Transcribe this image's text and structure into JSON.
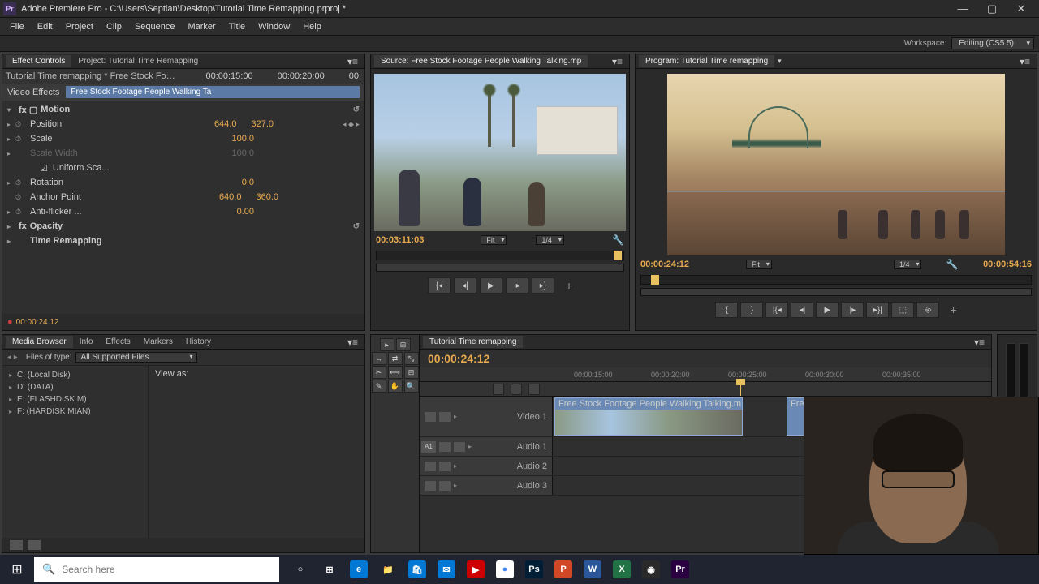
{
  "titlebar": {
    "logo_text": "Pr",
    "title": "Adobe Premiere Pro - C:\\Users\\Septian\\Desktop\\Tutorial Time Remapping.prproj *"
  },
  "menubar": [
    "File",
    "Edit",
    "Project",
    "Clip",
    "Sequence",
    "Marker",
    "Title",
    "Window",
    "Help"
  ],
  "workspace": {
    "label": "Workspace:",
    "value": "Editing (CS5.5)"
  },
  "effect_controls": {
    "tab1": "Effect Controls",
    "tab2": "Project: Tutorial Time Remapping",
    "clip_path": "Tutorial Time remapping * Free Stock Foota...",
    "time1": "00:00:15:00",
    "time2": "00:00:20:00",
    "time3": "00:",
    "video_effects_label": "Video Effects",
    "highlighted_clip": "Free Stock Footage People Walking Ta",
    "motion": "Motion",
    "position": {
      "label": "Position",
      "x": "644.0",
      "y": "327.0"
    },
    "scale": {
      "label": "Scale",
      "v": "100.0"
    },
    "scale_width": {
      "label": "Scale Width",
      "v": "100.0"
    },
    "uniform": "Uniform Sca...",
    "rotation": {
      "label": "Rotation",
      "v": "0.0"
    },
    "anchor": {
      "label": "Anchor Point",
      "x": "640.0",
      "y": "360.0"
    },
    "antiflicker": {
      "label": "Anti-flicker ...",
      "v": "0.00"
    },
    "opacity": "Opacity",
    "time_remapping": "Time Remapping",
    "footer_time": "00:00:24.12"
  },
  "source": {
    "tab": "Source: Free Stock Footage People Walking Talking.mp",
    "timecode": "00:03:11:03",
    "fit": "Fit",
    "zoom": "1/4"
  },
  "program": {
    "tab": "Program: Tutorial Time remapping",
    "timecode": "00:00:24:12",
    "fit": "Fit",
    "zoom": "1/4",
    "duration": "00:00:54:16"
  },
  "media_browser": {
    "tab1": "Media Browser",
    "tab2": "Info",
    "tab3": "Effects",
    "tab4": "Markers",
    "tab5": "History",
    "files_of_type": "Files of type:",
    "filter": "All Supported Files",
    "view_as": "View as:",
    "drives": [
      "C: (Local Disk)",
      "D: (DATA)",
      "E: (FLASHDISK M)",
      "F: (HARDISK MIAN)"
    ]
  },
  "timeline": {
    "tab": "Tutorial Time remapping",
    "timecode": "00:00:24:12",
    "ticks": [
      "00:00:15:00",
      "00:00:20:00",
      "00:00:25:00",
      "00:00:30:00",
      "00:00:35:00"
    ],
    "video1": "Video 1",
    "audio1": "Audio 1",
    "audio2": "Audio 2",
    "audio3": "Audio 3",
    "a1": "A1",
    "clip1": "Free Stock Footage People Walking Talking.m",
    "clip2": "Free Stock Footage People Walki"
  },
  "taskbar": {
    "search_placeholder": "Search here",
    "apps": [
      {
        "name": "cortana",
        "glyph": "○",
        "bg": "transparent",
        "fg": "#fff"
      },
      {
        "name": "taskview",
        "glyph": "⊞",
        "bg": "transparent",
        "fg": "#fff"
      },
      {
        "name": "edge",
        "glyph": "e",
        "bg": "#0078d4"
      },
      {
        "name": "explorer",
        "glyph": "📁",
        "bg": "transparent"
      },
      {
        "name": "store",
        "glyph": "🛍",
        "bg": "#0078d4"
      },
      {
        "name": "mail",
        "glyph": "✉",
        "bg": "#0078d4"
      },
      {
        "name": "youtube",
        "glyph": "▶",
        "bg": "#cc0000"
      },
      {
        "name": "chrome",
        "glyph": "●",
        "bg": "#fff",
        "fg": "#4285f4"
      },
      {
        "name": "photoshop",
        "glyph": "Ps",
        "bg": "#001e36"
      },
      {
        "name": "powerpoint",
        "glyph": "P",
        "bg": "#d24726"
      },
      {
        "name": "word",
        "glyph": "W",
        "bg": "#2b579a"
      },
      {
        "name": "excel",
        "glyph": "X",
        "bg": "#217346"
      },
      {
        "name": "obs",
        "glyph": "◉",
        "bg": "#2a2a2a"
      },
      {
        "name": "premiere",
        "glyph": "Pr",
        "bg": "#2a0041"
      }
    ]
  }
}
